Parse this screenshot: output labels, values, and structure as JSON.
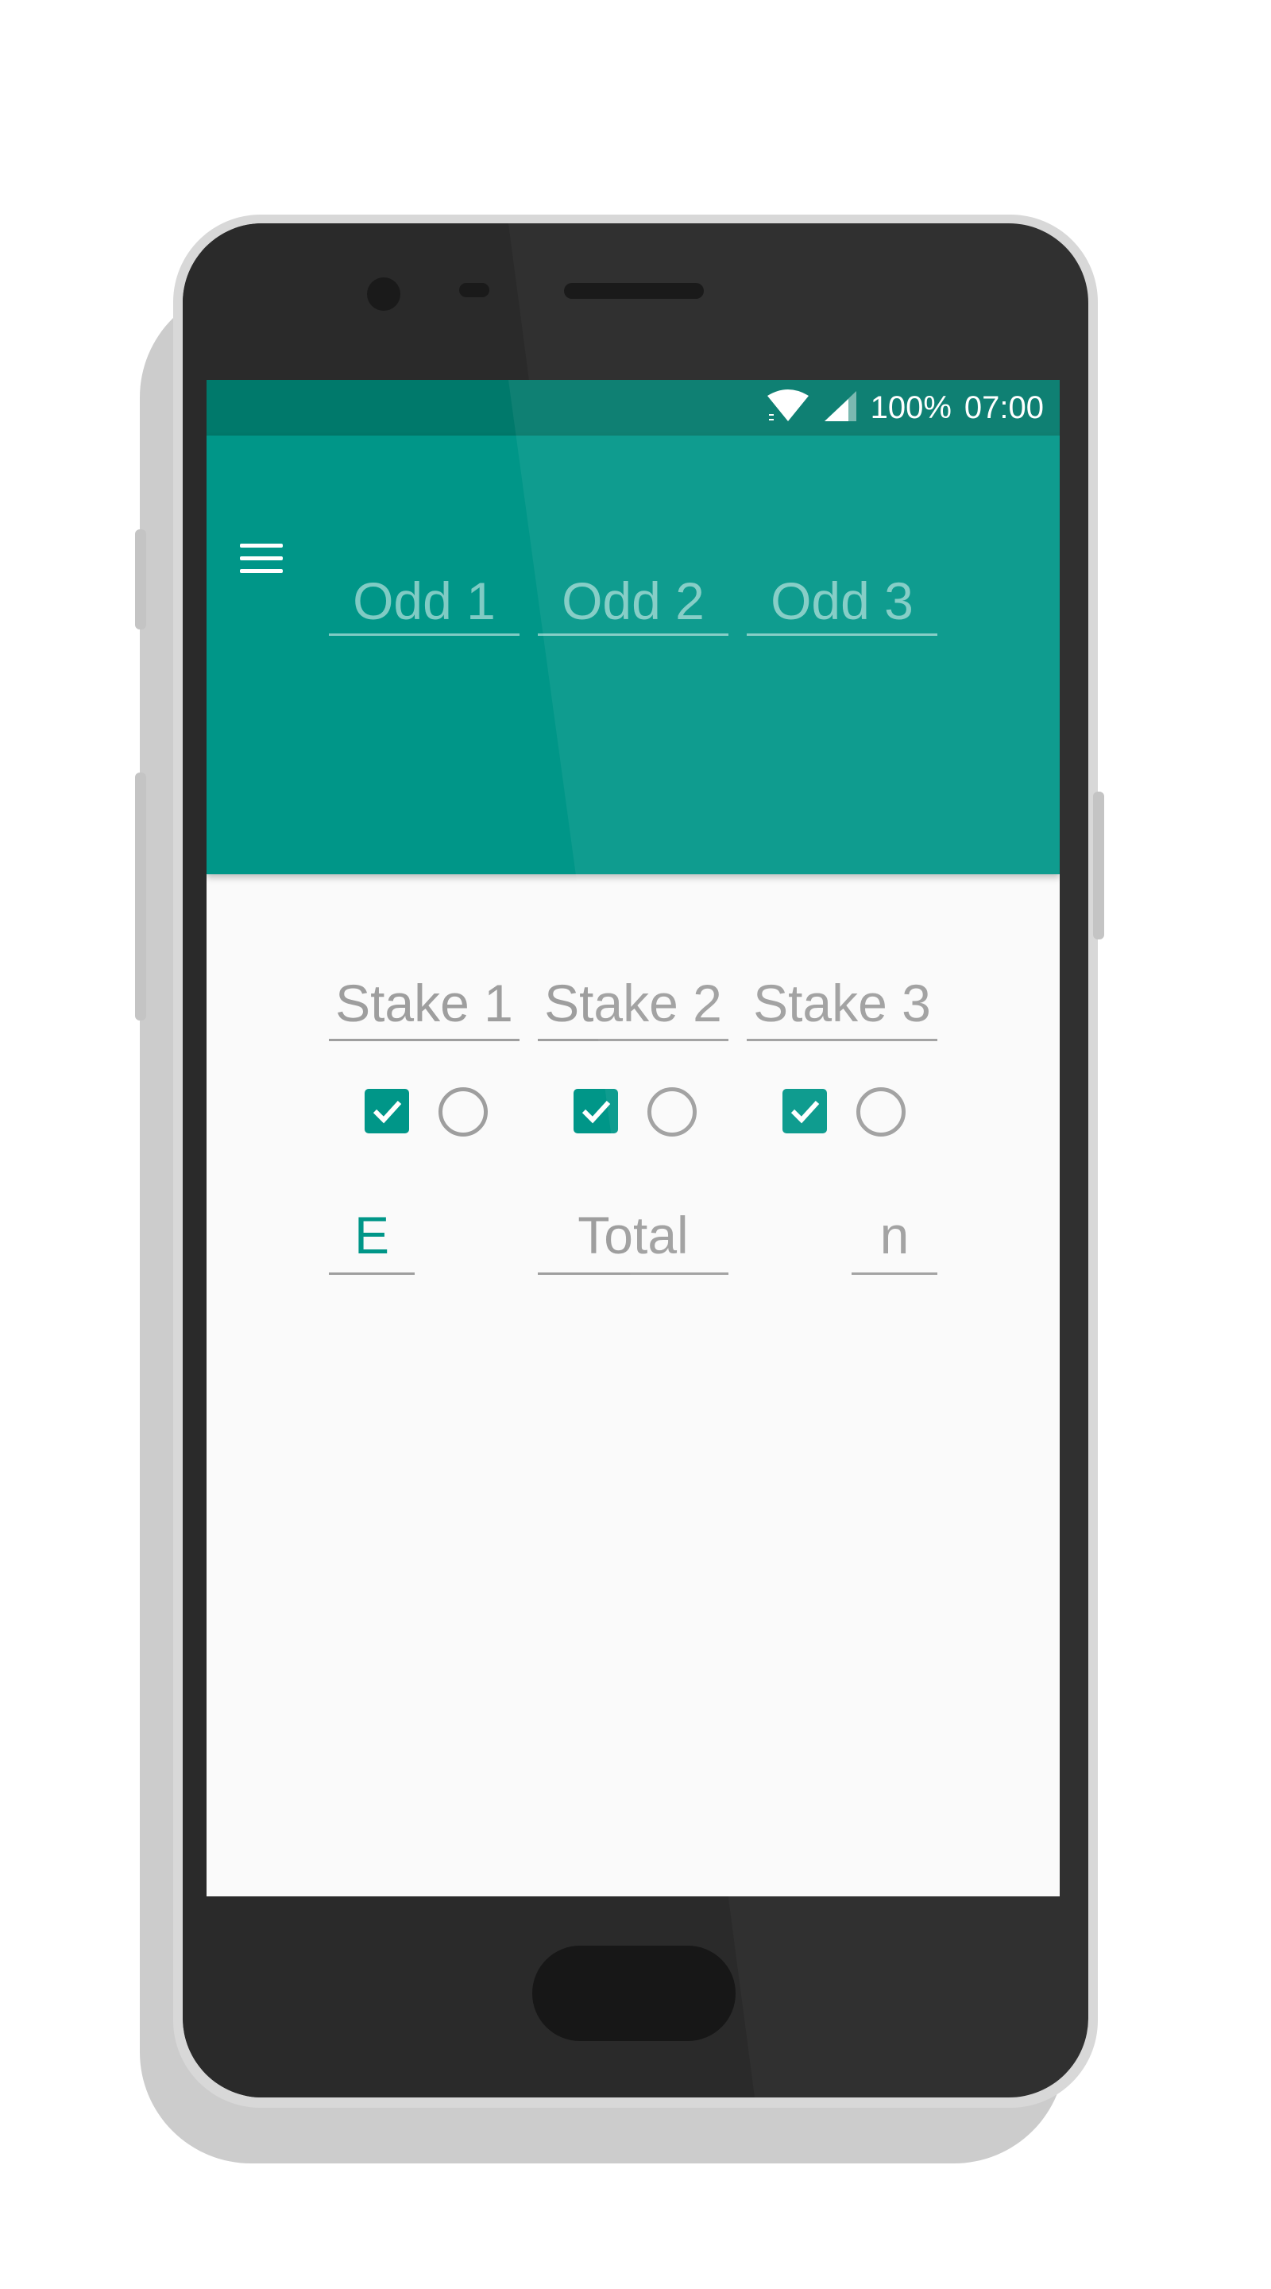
{
  "status_bar": {
    "battery": "100%",
    "time": "07:00",
    "icons": [
      "wifi-icon",
      "signal-icon"
    ]
  },
  "toolbar": {
    "menu_icon": "menu-icon",
    "odds": [
      {
        "placeholder": "Odd 1"
      },
      {
        "placeholder": "Odd 2"
      },
      {
        "placeholder": "Odd 3"
      }
    ]
  },
  "main": {
    "stakes": [
      {
        "placeholder": "Stake 1",
        "checked": true,
        "radio_selected": false
      },
      {
        "placeholder": "Stake 2",
        "checked": true,
        "radio_selected": false
      },
      {
        "placeholder": "Stake 3",
        "checked": true,
        "radio_selected": false
      }
    ],
    "result_row": {
      "left_value": "E",
      "total_placeholder": "Total",
      "right_value": "n"
    }
  },
  "colors": {
    "primary": "#009688",
    "primary_dark": "#00796b",
    "accent": "#009688",
    "hint": "#9e9e9e",
    "background": "#fafafa"
  }
}
